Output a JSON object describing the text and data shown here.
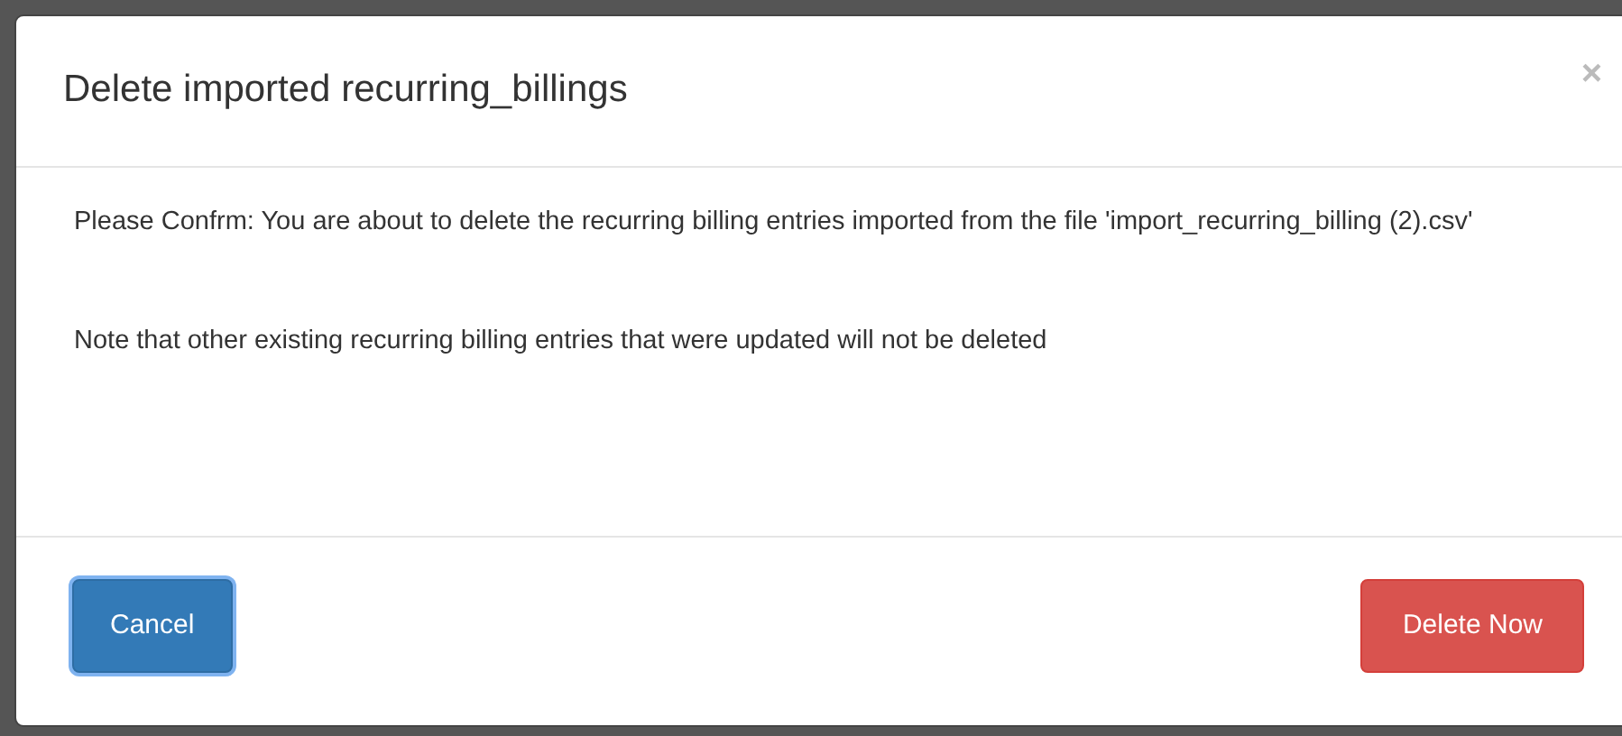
{
  "dialog": {
    "title": "Delete imported recurring_billings",
    "close": "×",
    "paragraphs": [
      "Please Confrm: You are about to delete the recurring billing entries imported from the file 'import_recurring_billing (2).csv'",
      "Note that other existing recurring billing entries that were updated will not be deleted"
    ],
    "buttons": [
      {
        "label": "Cancel",
        "kind": "primary",
        "focused": true
      },
      {
        "label": "Delete Now",
        "kind": "danger",
        "focused": false
      }
    ]
  }
}
